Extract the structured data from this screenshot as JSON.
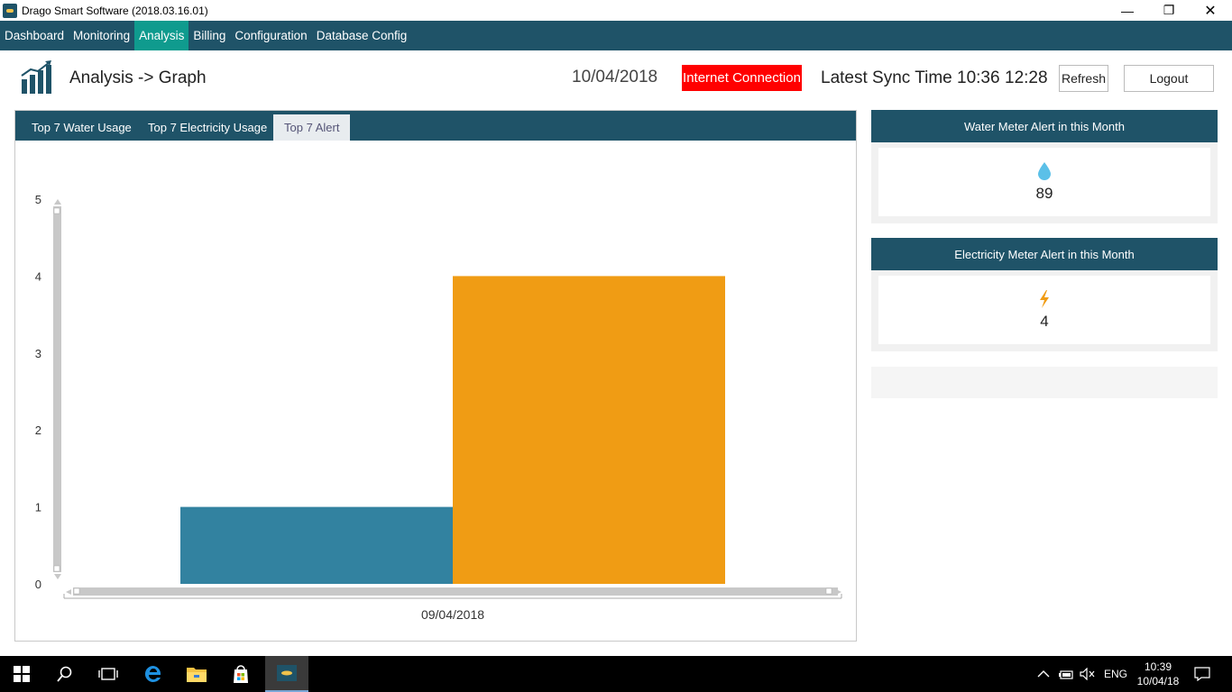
{
  "window": {
    "title": "Drago Smart Software (2018.03.16.01)"
  },
  "menu": {
    "items": [
      "Dashboard",
      "Monitoring",
      "Analysis",
      "Billing",
      "Configuration",
      "Database Config"
    ],
    "active": "Analysis"
  },
  "header": {
    "title": "Analysis -> Graph",
    "date": "10/04/2018",
    "connection_status": "Internet Connection",
    "sync_label": "Latest Sync Time 10:36",
    "clock": "12:28",
    "refresh_label": "Refresh",
    "logout_label": "Logout"
  },
  "tabs": [
    {
      "label": "Top 7 Water Usage"
    },
    {
      "label": "Top 7 Electricity Usage"
    },
    {
      "label": "Top 7 Alert"
    }
  ],
  "chart_data": {
    "type": "bar",
    "categories": [
      "09/04/2018"
    ],
    "series": [
      {
        "values": [
          1
        ],
        "color": "#3282a0"
      },
      {
        "values": [
          4
        ],
        "color": "#f09c14"
      }
    ],
    "y_ticks": [
      "0",
      "1",
      "2",
      "3",
      "4",
      "5"
    ],
    "ylim": [
      0,
      5
    ],
    "grid": false,
    "legend": "none"
  },
  "cards": {
    "water": {
      "title": "Water Meter Alert in this Month",
      "value": "89",
      "icon": "water-drop-icon",
      "color": "#5bc0e8"
    },
    "electricity": {
      "title": "Electricity Meter Alert in this Month",
      "value": "4",
      "icon": "lightning-icon",
      "color": "#f09c14"
    }
  },
  "taskbar": {
    "tray_language": "ENG",
    "time": "10:39",
    "date": "10/04/18"
  }
}
